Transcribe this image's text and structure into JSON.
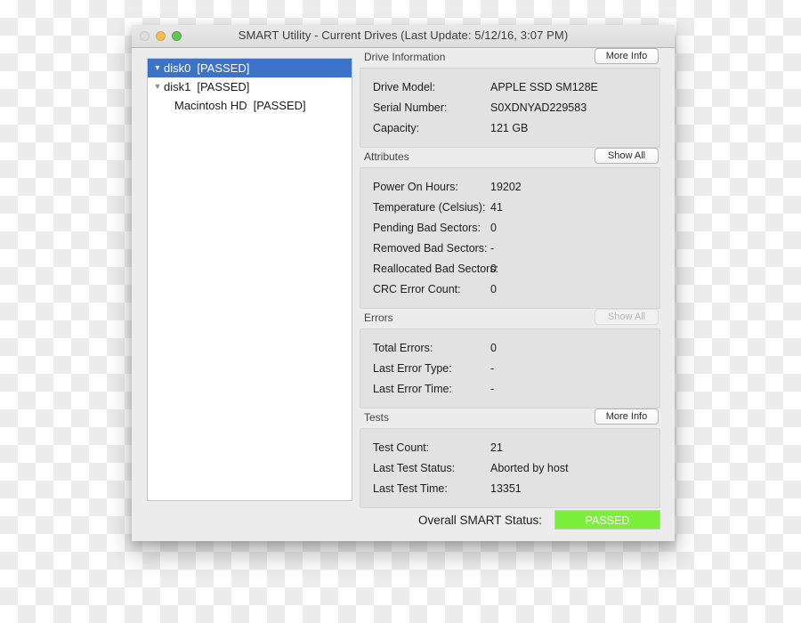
{
  "window": {
    "title": "SMART Utility - Current Drives (Last Update: 5/12/16, 3:07 PM)",
    "traffic_lights": {
      "close": "close-button",
      "minimize": "minimize-button",
      "zoom": "zoom-button"
    }
  },
  "drive_list": {
    "items": [
      {
        "disclosure": "▼",
        "name": "disk0",
        "status": "[PASSED]",
        "selected": true,
        "indented": false
      },
      {
        "disclosure": "▼",
        "name": "disk1",
        "status": "[PASSED]",
        "selected": false,
        "indented": false
      },
      {
        "disclosure": "",
        "name": "Macintosh HD",
        "status": "[PASSED]",
        "selected": false,
        "indented": true
      }
    ]
  },
  "sections": [
    {
      "title": "Drive Information",
      "button": {
        "label": "More Info",
        "enabled": true
      },
      "rows": [
        {
          "label": "Drive Model:",
          "value": "APPLE SSD SM128E"
        },
        {
          "label": "Serial Number:",
          "value": "S0XDNYAD229583"
        },
        {
          "label": "Capacity:",
          "value": "121 GB"
        }
      ]
    },
    {
      "title": "Attributes",
      "button": {
        "label": "Show All",
        "enabled": true
      },
      "rows": [
        {
          "label": "Power On Hours:",
          "value": "19202"
        },
        {
          "label": "Temperature (Celsius):",
          "value": "41"
        },
        {
          "label": "Pending Bad Sectors:",
          "value": "0"
        },
        {
          "label": "Removed Bad Sectors:",
          "value": "-"
        },
        {
          "label": "Reallocated Bad Sectors:",
          "value": "0"
        },
        {
          "label": "CRC Error Count:",
          "value": "0"
        }
      ]
    },
    {
      "title": "Errors",
      "button": {
        "label": "Show All",
        "enabled": false
      },
      "rows": [
        {
          "label": "Total Errors:",
          "value": "0"
        },
        {
          "label": "Last Error Type:",
          "value": "-"
        },
        {
          "label": "Last Error Time:",
          "value": "-"
        }
      ]
    },
    {
      "title": "Tests",
      "button": {
        "label": "More Info",
        "enabled": true
      },
      "rows": [
        {
          "label": "Test Count:",
          "value": "21"
        },
        {
          "label": "Last Test Status:",
          "value": "Aborted by host"
        },
        {
          "label": "Last Test Time:",
          "value": "13351"
        }
      ]
    }
  ],
  "overall": {
    "label": "Overall SMART Status:",
    "status": "PASSED",
    "status_color": "#7bf03c"
  }
}
